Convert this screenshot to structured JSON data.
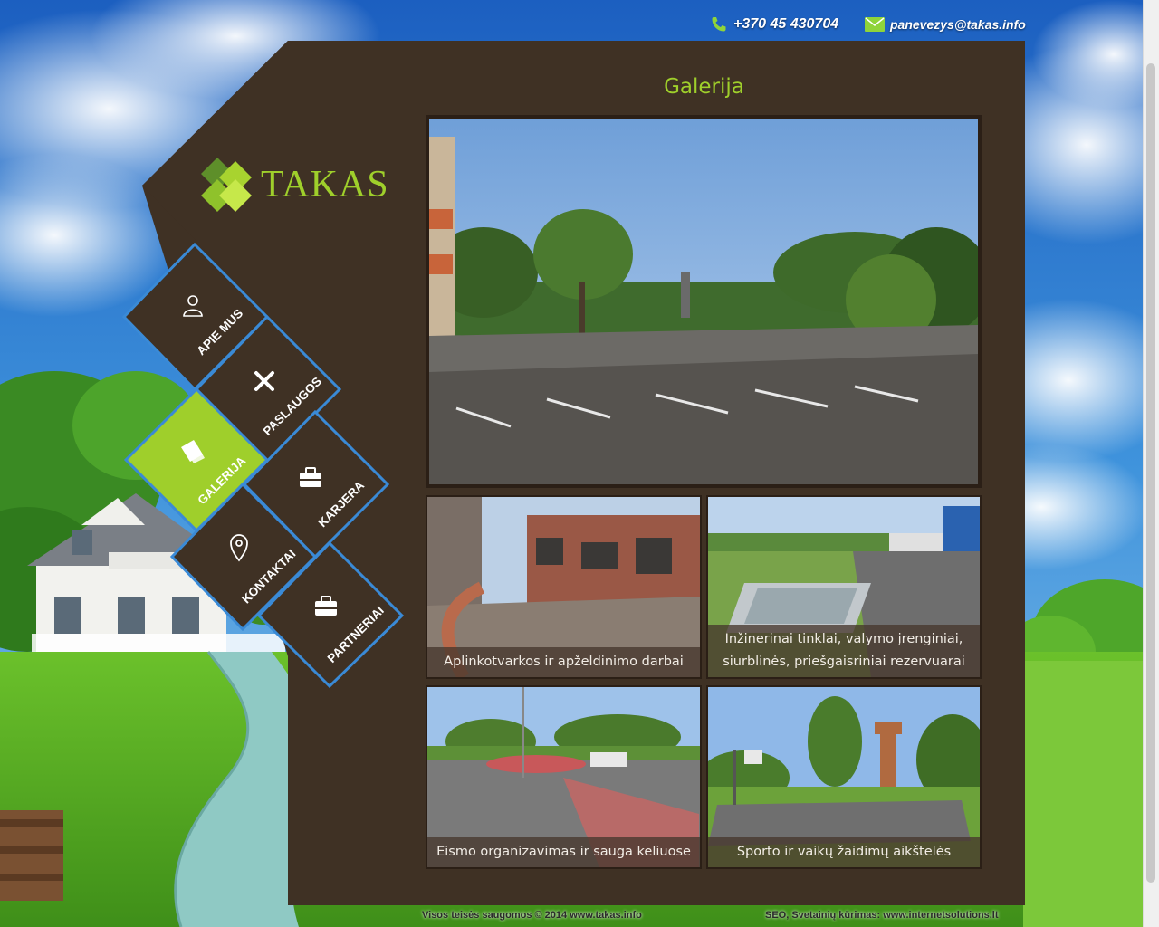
{
  "contact": {
    "phone": "+370 45 430704",
    "email": "panevezys@takas.info"
  },
  "logo": {
    "text": "TAKAS"
  },
  "page": {
    "title": "Galerija"
  },
  "nav": {
    "items": [
      {
        "label": "APIE MUS",
        "icon": "user-icon"
      },
      {
        "label": "PASLAUGOS",
        "icon": "tools-icon"
      },
      {
        "label": "GALERIJA",
        "icon": "gallery-icon",
        "active": true
      },
      {
        "label": "KARJERA",
        "icon": "briefcase-icon"
      },
      {
        "label": "KONTAKTAI",
        "icon": "map-pin-icon"
      },
      {
        "label": "PARTNERIAI",
        "icon": "briefcase-icon"
      }
    ]
  },
  "gallery": {
    "items": [
      {
        "caption": "Aplinkotvarkos ir apželdinimo darbai"
      },
      {
        "caption_line1": "Inžinerinai tinklai, valymo įrenginiai,",
        "caption_line2": "siurblinės, priešgaisriniai rezervuarai"
      },
      {
        "caption": "Eismo organizavimas ir sauga keliuose"
      },
      {
        "caption": "Sporto ir vaikų žaidimų aikštelės"
      }
    ]
  },
  "footer": {
    "left": "Visos teisės saugomos © 2014  www.takas.info",
    "right": "SEO, Svetainių kūrimas: www.internetsolutions.lt"
  },
  "colors": {
    "panel": "#3f3124",
    "accent_green": "#9fcf2b",
    "nav_border": "#3a8ad6"
  }
}
